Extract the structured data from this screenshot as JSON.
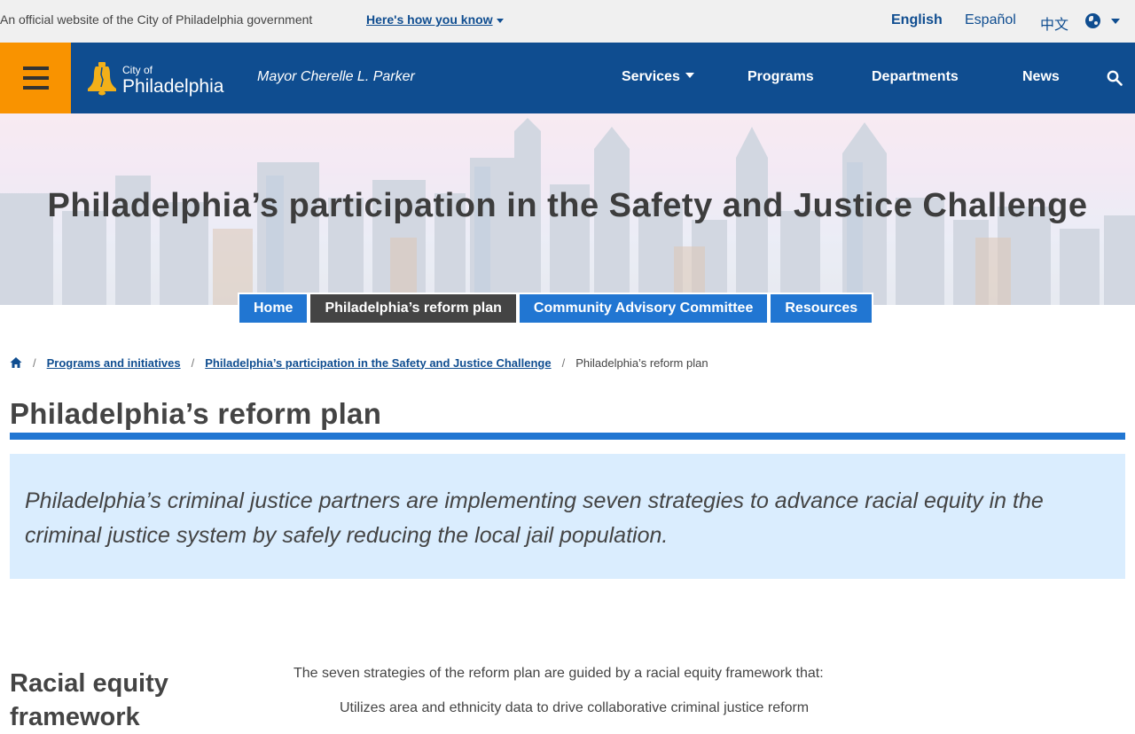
{
  "gov_bar": {
    "text": "An official website of the City of Philadelphia government",
    "link": "Here's how you know",
    "languages": [
      "English",
      "Español",
      "中文"
    ]
  },
  "nav": {
    "logo_small": "City of",
    "logo_big": "Philadelphia",
    "mayor": "Mayor Cherelle L. Parker",
    "items": [
      "Services",
      "Programs",
      "Departments",
      "News"
    ]
  },
  "hero": {
    "title": "Philadelphia’s participation in the Safety and Justice Challenge"
  },
  "tabs": [
    "Home",
    "Philadelphia’s reform plan",
    "Community Advisory Committee",
    "Resources"
  ],
  "breadcrumb": {
    "items": [
      "Programs and initiatives",
      "Philadelphia’s participation in the Safety and Justice Challenge"
    ],
    "current": "Philadelphia’s reform plan"
  },
  "page": {
    "title": "Philadelphia’s reform plan",
    "callout": "Philadelphia’s criminal justice partners are implementing seven strategies to advance racial equity in the criminal justice system by safely reducing the local jail population.",
    "section_heading": "Racial equity framework",
    "body_intro": "The seven strategies of the reform plan are guided by a racial equity framework that:",
    "list_first": "Utilizes area and ethnicity data to drive collaborative criminal justice reform"
  },
  "colors": {
    "brand_blue": "#0f4d90",
    "accent_orange": "#f99300",
    "link_blue": "#2176d2",
    "callout_bg": "#daedfe",
    "active_tab": "#444444"
  },
  "icons": [
    "hamburger-menu-icon",
    "liberty-bell-icon",
    "search-icon",
    "globe-icon",
    "home-icon"
  ]
}
